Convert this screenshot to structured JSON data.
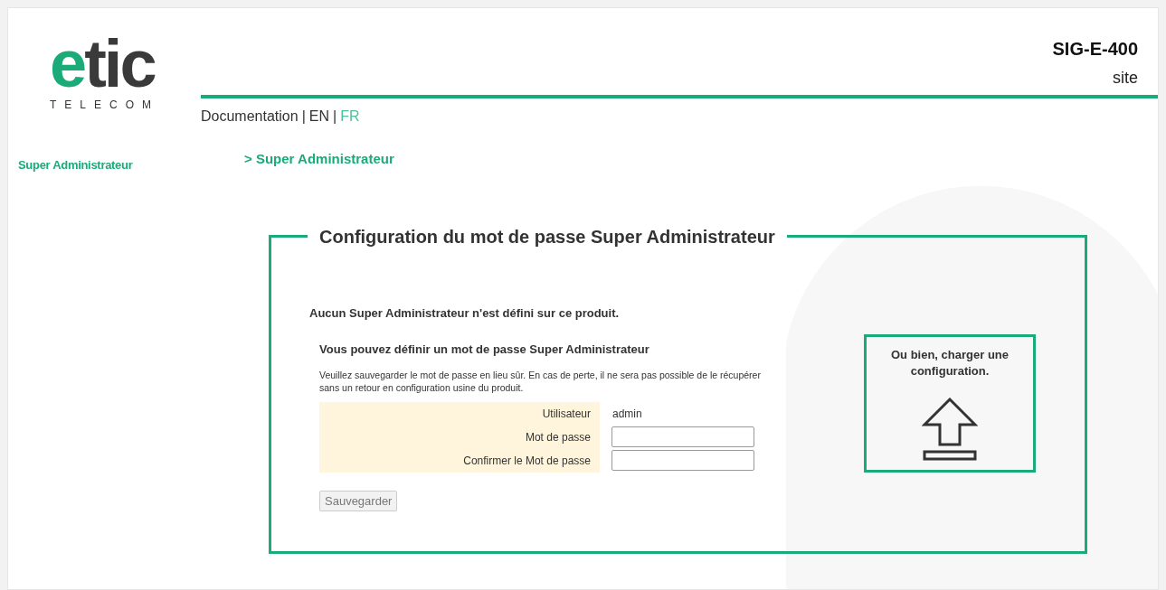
{
  "logo": {
    "word": "etic",
    "tagline": "TELECOM"
  },
  "device": {
    "model": "SIG-E-400",
    "site": "site"
  },
  "nav": {
    "separator": "|",
    "items": [
      {
        "label": "Documentation",
        "selected": false
      },
      {
        "label": "EN",
        "selected": false
      },
      {
        "label": "FR",
        "selected": true
      }
    ]
  },
  "sidebar": {
    "items": [
      {
        "label": "Super Administrateur",
        "selected": true
      }
    ]
  },
  "breadcrumb": "> Super Administrateur",
  "panel": {
    "title": "Configuration du mot de passe Super Administrateur",
    "notice": "Aucun Super Administrateur n'est défini sur ce produit.",
    "subtitle": "Vous pouvez définir un mot de passe Super Administrateur",
    "help": "Veuillez sauvegarder le mot de passe en lieu sûr. En cas de perte, il ne sera pas possible de le récupérer sans un retour en configuration usine du produit.",
    "fields": [
      {
        "kind": "text",
        "label": "Utilisateur",
        "value": "admin"
      },
      {
        "kind": "input",
        "label": "Mot de passe"
      },
      {
        "kind": "input",
        "label": "Confirmer le Mot de passe"
      }
    ],
    "save_button": "Sauvegarder",
    "upload": {
      "label": "Ou bien, charger une configuration."
    }
  }
}
